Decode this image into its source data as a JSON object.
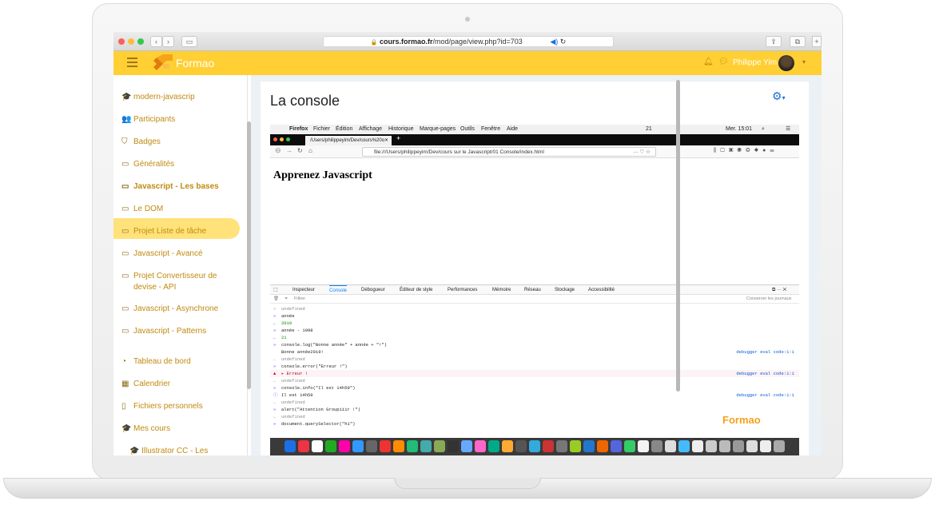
{
  "safari": {
    "url_domain": "cours.formao.fr",
    "url_path": "/mod/page/view.php?id=703"
  },
  "header": {
    "brand": "Formao",
    "user_name": "Philippe Yim"
  },
  "sidebar": {
    "items": [
      {
        "label": "modern-javascrip",
        "icon": "graduation-cap-icon",
        "glyph": "🎓"
      },
      {
        "label": "Participants",
        "icon": "users-icon",
        "glyph": "👥"
      },
      {
        "label": "Badges",
        "icon": "shield-icon",
        "glyph": "⛉"
      },
      {
        "label": "Généralités",
        "icon": "folder-icon",
        "glyph": "▭"
      },
      {
        "label": "Javascript - Les bases",
        "icon": "folder-icon",
        "glyph": "▭",
        "active": true
      },
      {
        "label": "Le DOM",
        "icon": "folder-icon",
        "glyph": "▭"
      },
      {
        "label": "Projet Liste de tâche",
        "icon": "folder-icon",
        "glyph": "▭"
      },
      {
        "label": "Javascript - Avancé",
        "icon": "folder-icon",
        "glyph": "▭"
      },
      {
        "label": "Projet Convertisseur de",
        "label2": "devise - API",
        "icon": "folder-icon",
        "glyph": "▭"
      },
      {
        "label": "Javascript - Asynchrone",
        "icon": "folder-icon",
        "glyph": "▭"
      },
      {
        "label": "Javascript - Patterns",
        "icon": "folder-icon",
        "glyph": "▭"
      },
      {
        "label": "Tableau de bord",
        "icon": "dashboard-icon",
        "glyph": "◔"
      },
      {
        "label": "Calendrier",
        "icon": "calendar-icon",
        "glyph": "▦"
      },
      {
        "label": "Fichiers personnels",
        "icon": "file-icon",
        "glyph": "▯"
      },
      {
        "label": "Mes cours",
        "icon": "graduation-cap-icon",
        "glyph": "🎓"
      },
      {
        "label": "Illustrator CC - Les",
        "icon": "graduation-cap-icon",
        "glyph": "🎓"
      }
    ]
  },
  "main": {
    "title": "La console"
  },
  "screenshot": {
    "mac_menu": [
      "Firefox",
      "Fichier",
      "Édition",
      "Affichage",
      "Historique",
      "Marque-pages",
      "Outils",
      "Fenêtre",
      "Aide"
    ],
    "mac_clock": "Mer. 15:01",
    "mac_percent": "21",
    "tab_title": "/Users/philippeyim/Dev/cours%20o",
    "url": "file:///Users/philippeyim/Dev/cours sur le Javascript/01 Console/index.html",
    "page_heading": "Apprenez Javascript",
    "devtools_tabs": [
      "Inspecteur",
      "Console",
      "Débogueur",
      "Éditeur de style",
      "Performances",
      "Mémoire",
      "Réseau",
      "Stockage",
      "Accessibilité"
    ],
    "filter_placeholder": "Filtrer",
    "persist_logs": "Conserver les journaux",
    "watermark": "Formao",
    "console": [
      {
        "p": "»",
        "t": "undefined",
        "k": "out"
      },
      {
        "p": "»",
        "t": "année",
        "k": "kw"
      },
      {
        "p": "←",
        "t": "2019",
        "k": "num"
      },
      {
        "p": "»",
        "t": "année - 1998",
        "k": "kw"
      },
      {
        "p": "←",
        "t": "21",
        "k": "num"
      },
      {
        "p": "»",
        "t": "console.log(\"Bonne année\" + année + \"!\")",
        "k": "kw"
      },
      {
        "p": "",
        "t": "Bonne année2019!",
        "k": "plain",
        "src": "debugger eval code:1:1"
      },
      {
        "p": "←",
        "t": "undefined",
        "k": "out"
      },
      {
        "p": "»",
        "t": "console.error(\"Erreur !\")",
        "k": "kw"
      },
      {
        "p": "▲",
        "t": "▸ Erreur !",
        "k": "err",
        "src": "debugger eval code:1:1"
      },
      {
        "p": "←",
        "t": "undefined",
        "k": "out"
      },
      {
        "p": "»",
        "t": "console.info(\"Il est 14h59\")",
        "k": "kw"
      },
      {
        "p": "ⓘ",
        "t": "Il est 14h59",
        "k": "plain",
        "src": "debugger eval code:1:1"
      },
      {
        "p": "←",
        "t": "undefined",
        "k": "out"
      },
      {
        "p": "»",
        "t": "alert(\"Attention Groupiiir !\")",
        "k": "kw"
      },
      {
        "p": "←",
        "t": "undefined",
        "k": "out"
      },
      {
        "p": "»",
        "t": "document.querySelector(\"h1\")",
        "k": "kw"
      }
    ]
  }
}
